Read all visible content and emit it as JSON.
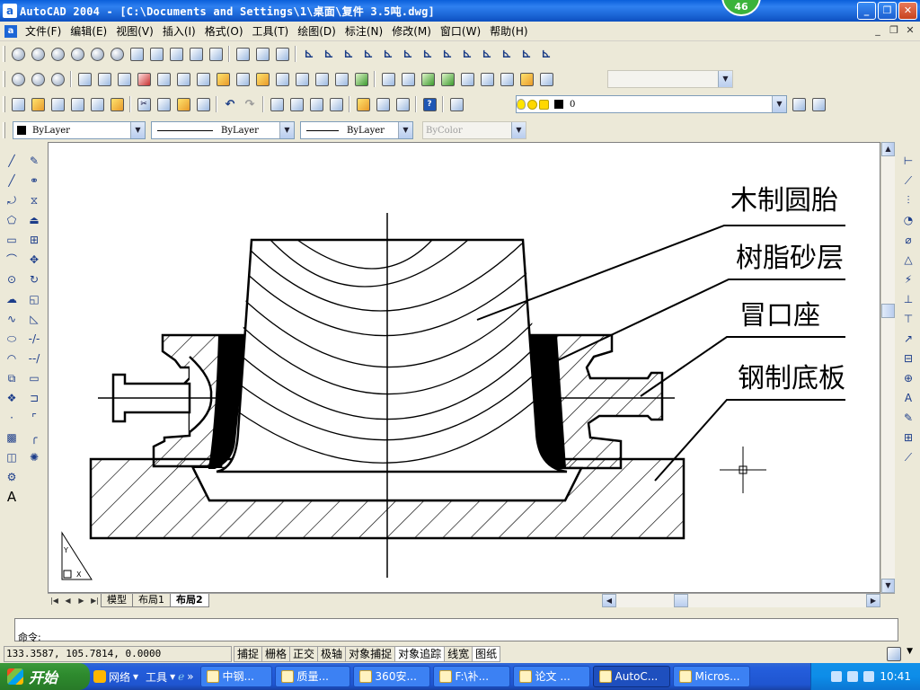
{
  "window": {
    "title": "AutoCAD 2004 - [C:\\Documents and Settings\\1\\桌面\\复件 3.5吨.dwg]",
    "app_icon": "a",
    "badge": "46",
    "buttons": [
      "_",
      "❐",
      "✕"
    ]
  },
  "menu": {
    "items": [
      "文件(F)",
      "编辑(E)",
      "视图(V)",
      "插入(I)",
      "格式(O)",
      "工具(T)",
      "绘图(D)",
      "标注(N)",
      "修改(M)",
      "窗口(W)",
      "帮助(H)"
    ],
    "mdi_buttons": [
      "_",
      "❐",
      "✕"
    ]
  },
  "properties": {
    "color": "ByLayer",
    "linetype": "ByLayer",
    "lineweight": "ByLayer",
    "plotstyle": "ByColor",
    "layer": "0"
  },
  "drawing": {
    "labels": [
      "木制圆胎",
      "树脂砂层",
      "冒口座",
      "钢制底板"
    ],
    "ucs_x": "X",
    "ucs_y": "Y"
  },
  "layout_tabs": [
    "模型",
    "布局1",
    "布局2"
  ],
  "active_tab": "布局2",
  "command": {
    "prompt": "命令:"
  },
  "status": {
    "coords": "133.3587, 105.7814, 0.0000",
    "toggles": [
      {
        "label": "捕捉",
        "on": false
      },
      {
        "label": "栅格",
        "on": false
      },
      {
        "label": "正交",
        "on": false
      },
      {
        "label": "极轴",
        "on": false
      },
      {
        "label": "对象捕捉",
        "on": false
      },
      {
        "label": "对象追踪",
        "on": true
      },
      {
        "label": "线宽",
        "on": false
      },
      {
        "label": "图纸",
        "on": true
      }
    ]
  },
  "taskbar": {
    "start": "开始",
    "quicklaunch": [
      "网络",
      "工具"
    ],
    "tasks": [
      "中钢...",
      "质量...",
      "360安...",
      "F:\\补...",
      "论文 ...",
      "AutoC...",
      "Micros..."
    ],
    "active_task": "AutoC...",
    "clock": "10:41"
  }
}
